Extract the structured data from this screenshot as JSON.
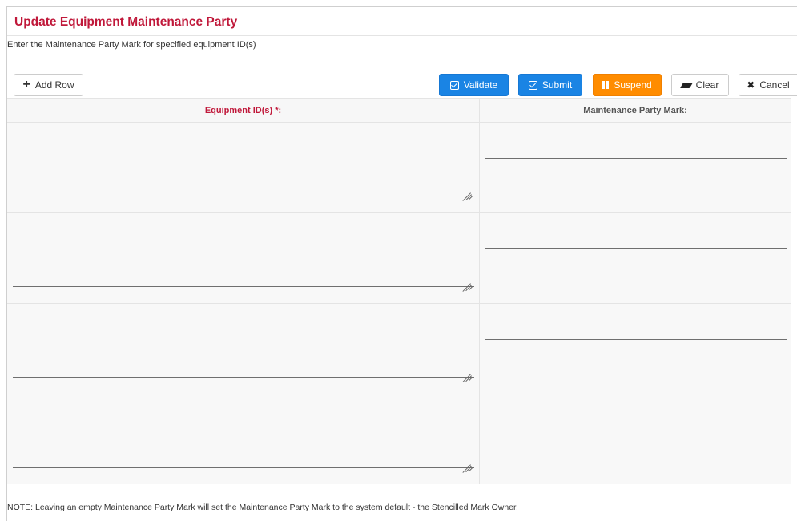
{
  "page": {
    "title": "Update Equipment Maintenance Party",
    "subtitle": "Enter the Maintenance Party Mark for specified equipment ID(s)",
    "note": "NOTE: Leaving an empty Maintenance Party Mark will set the Maintenance Party Mark to the system default - the Stencilled Mark Owner."
  },
  "toolbar": {
    "add_row_label": "Add Row",
    "validate_label": "Validate",
    "submit_label": "Submit",
    "suspend_label": "Suspend",
    "clear_label": "Clear",
    "cancel_label": "Cancel"
  },
  "icons": {
    "add_row": "plus-icon",
    "validate": "check-square-icon",
    "submit": "check-square-icon",
    "suspend": "pause-icon",
    "clear": "eraser-icon",
    "cancel": "close-icon"
  },
  "colors": {
    "accent": "#c0183a",
    "primary": "#1a84e4",
    "warning": "#ff8c00"
  },
  "grid": {
    "columns": [
      "Equipment ID(s) *:",
      "Maintenance Party Mark:"
    ],
    "rows": [
      {
        "equipment_ids": "",
        "maintenance_party_mark": ""
      },
      {
        "equipment_ids": "",
        "maintenance_party_mark": ""
      },
      {
        "equipment_ids": "",
        "maintenance_party_mark": ""
      },
      {
        "equipment_ids": "",
        "maintenance_party_mark": ""
      }
    ]
  }
}
